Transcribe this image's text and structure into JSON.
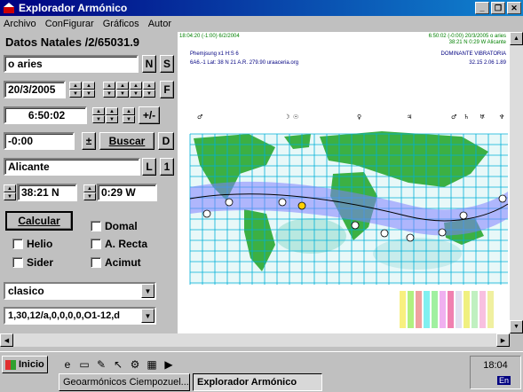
{
  "window": {
    "title": "Explorador Armónico",
    "minimize": "_",
    "maximize": "❐",
    "close": "✕"
  },
  "menu": [
    "Archivo",
    "ConFigurar",
    "Gráficos",
    "Autor"
  ],
  "panel": {
    "title": "Datos Natales /2/65031.9",
    "name_value": "o aries",
    "btn_n": "N",
    "btn_s": "S",
    "date_value": "20/3/2005",
    "btn_f": "F",
    "time_value": "6:50:02",
    "btn_plusminus": "+/-",
    "tz_value": "-0:00",
    "btn_pm": "±",
    "btn_buscar": "Buscar",
    "btn_d": "D",
    "place_value": "Alicante",
    "btn_l": "L",
    "btn_1": "1",
    "lat_value": "38:21 N",
    "lon_value": "0:29 W",
    "btn_calcular": "Calcular",
    "chk_domal": "Domal",
    "chk_helio": "Helio",
    "chk_arecta": "A. Recta",
    "chk_sider": "Sider",
    "chk_acimut": "Acimut",
    "combo1_value": "clasico",
    "combo2_value": "1,30,12/a,0,0,0,0,O1-12,d"
  },
  "chart": {
    "header_left_1": "18:04:20 (-1:00) 6/2/2004",
    "header_left_2": "Phemjsung x1 H:S 6",
    "header_left_3": "6A6.-1 Lat: 38 N 21   A.R. 279.90  uraaceria.org",
    "header_right_1": "6:50:02 (-0:00) 20/3/2005 o aries",
    "header_right_2": "38:21 N  0:29 W  Alicante",
    "header_right_3": "DOMINANTE VIBRATORIA",
    "header_right_4": "32.15 2.06 1.89",
    "colors": {
      "land": "#3cb043",
      "grid": "#00b0d8",
      "band": "#8080ff",
      "ocean_tint": "#d0f0f0",
      "header_green": "#008000",
      "header_blue": "#000080"
    }
  },
  "taskbar": {
    "start_label": "Inicio",
    "task1": "Geoarmónicos Ciempozuel...",
    "task2": "Explorador Armónico",
    "clock": "18:04",
    "lang": "En"
  }
}
